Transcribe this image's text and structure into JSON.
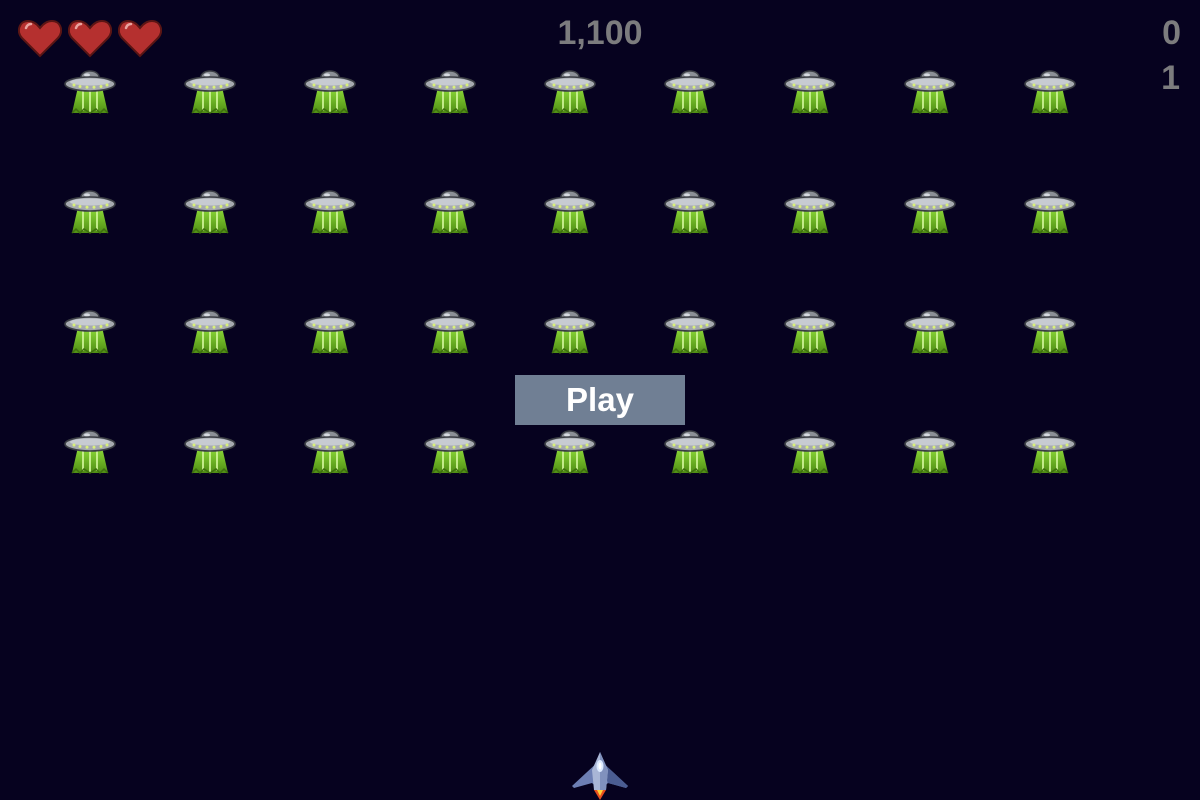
{
  "hud": {
    "score": "1,100",
    "high_score": "0",
    "level": "1",
    "lives": 3,
    "text_color": "#7c7c7e"
  },
  "play_button": {
    "label": "Play",
    "background_color": "#707f94",
    "text_color": "#ffffff"
  },
  "fleet": {
    "rows": 4,
    "columns": 9,
    "alien_icon": "ufo-alien-icon"
  },
  "ship": {
    "icon": "player-ship-icon"
  },
  "colors": {
    "background": "#06021f",
    "heart": "#b5302f",
    "alien_beam": "#8fdd3a",
    "alien_saucer": "#a6aab0"
  }
}
